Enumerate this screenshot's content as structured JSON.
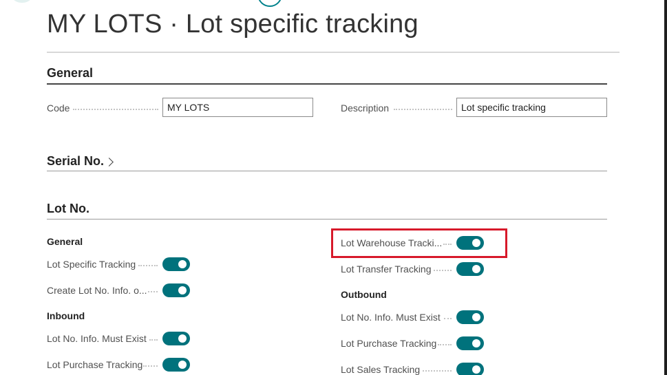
{
  "page": {
    "title": "MY LOTS · Lot specific tracking"
  },
  "general": {
    "heading": "General",
    "code_label": "Code",
    "code_value": "MY LOTS",
    "description_label": "Description",
    "description_value": "Lot specific tracking"
  },
  "serial": {
    "heading": "Serial No."
  },
  "lot": {
    "heading": "Lot No.",
    "left_groups": {
      "general_title": "General",
      "inbound_title": "Inbound"
    },
    "right_groups": {
      "outbound_title": "Outbound"
    },
    "toggles": {
      "lot_specific_tracking": {
        "label": "Lot Specific Tracking",
        "on": true
      },
      "create_lot_info": {
        "label": "Create Lot No. Info. o...",
        "on": true
      },
      "inbound_info_must_exist": {
        "label": "Lot No. Info. Must Exist",
        "on": true
      },
      "inbound_purchase_tracking": {
        "label": "Lot Purchase Tracking",
        "on": true
      },
      "warehouse_tracking": {
        "label": "Lot Warehouse Tracki...",
        "on": true
      },
      "transfer_tracking": {
        "label": "Lot Transfer Tracking",
        "on": true
      },
      "outbound_info_must_exist": {
        "label": "Lot No. Info. Must Exist",
        "on": true
      },
      "outbound_purchase_tracking": {
        "label": "Lot Purchase Tracking",
        "on": true
      },
      "sales_tracking": {
        "label": "Lot Sales Tracking",
        "on": true
      }
    }
  },
  "colors": {
    "toggle_on": "#00727c",
    "highlight": "#d7192a",
    "accent": "#00828c"
  }
}
